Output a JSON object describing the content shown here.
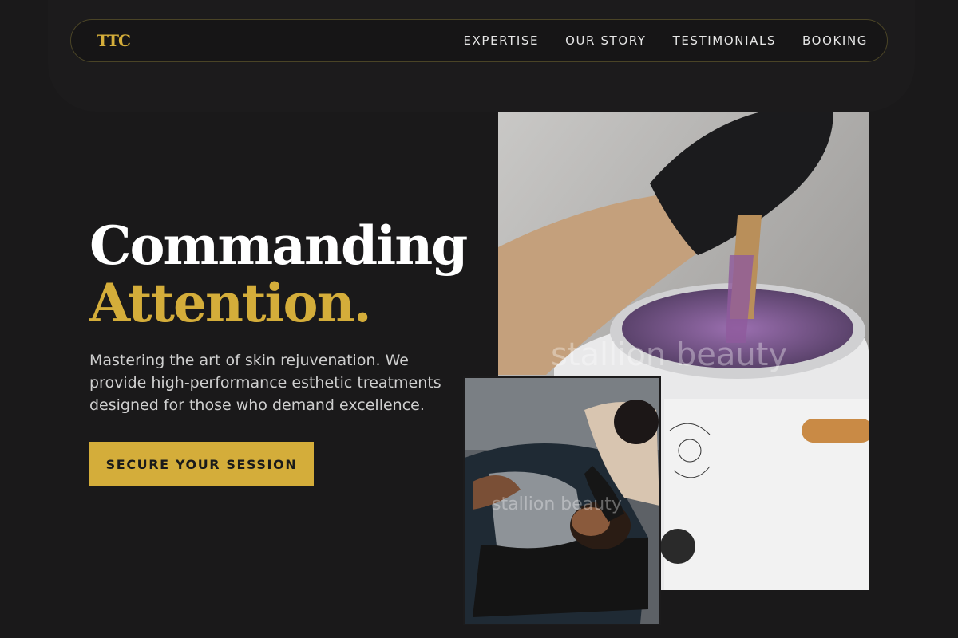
{
  "nav": {
    "logo": "TTC",
    "items": [
      {
        "label": "EXPERTISE"
      },
      {
        "label": "OUR STORY"
      },
      {
        "label": "TESTIMONIALS"
      },
      {
        "label": "BOOKING"
      }
    ]
  },
  "hero": {
    "headline_line1": "Commanding",
    "headline_line2": "Attention.",
    "description": "Mastering the art of skin rejuvenation. We provide high-performance esthetic treatments designed for those who demand excellence.",
    "cta_label": "SECURE YOUR SESSION"
  },
  "images": {
    "main_watermark": "stallion beauty",
    "small_watermark": "stallion beauty"
  },
  "colors": {
    "background": "#1a191a",
    "accent": "#d4ad3a",
    "text": "#ffffff"
  }
}
